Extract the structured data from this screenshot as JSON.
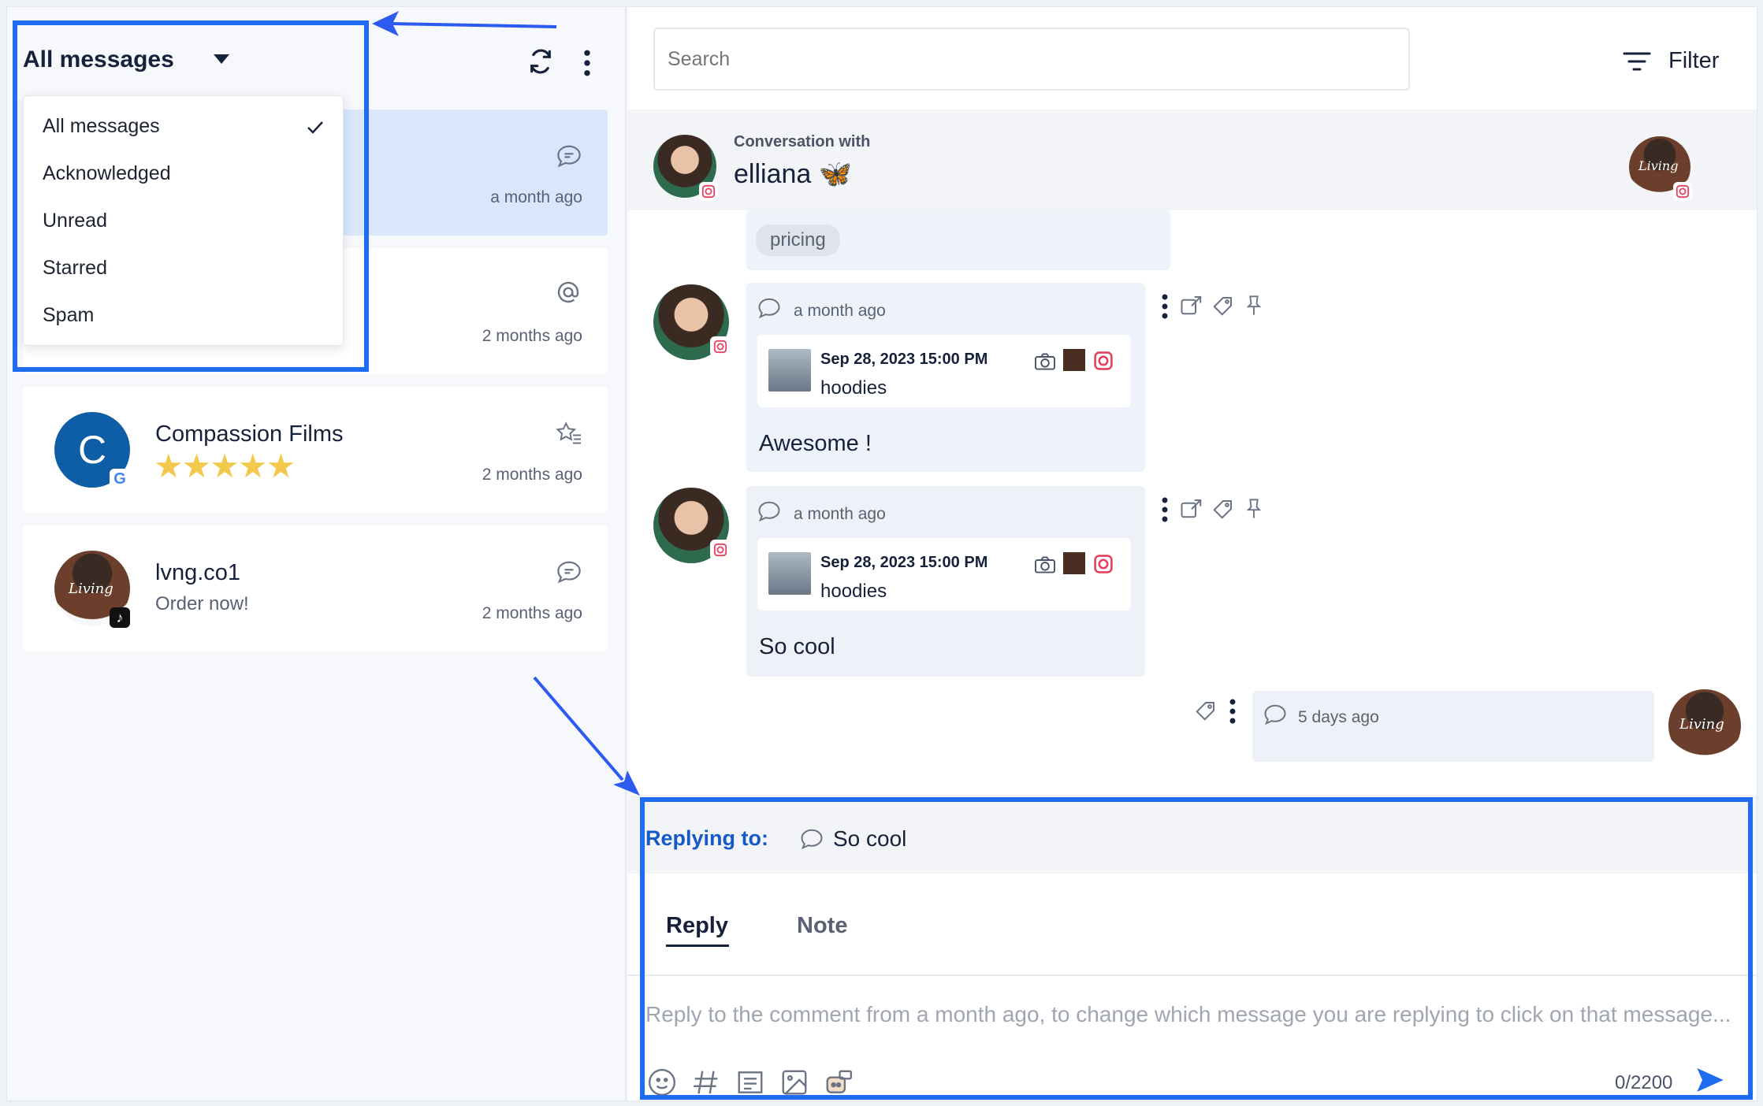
{
  "left_panel": {
    "filter_title": "All messages",
    "dropdown": {
      "items": [
        {
          "label": "All messages",
          "selected": true
        },
        {
          "label": "Acknowledged",
          "selected": false
        },
        {
          "label": "Unread",
          "selected": false
        },
        {
          "label": "Starred",
          "selected": false
        },
        {
          "label": "Spam",
          "selected": false
        }
      ]
    },
    "conversations": [
      {
        "name": "",
        "subtitle": "",
        "time": "a month ago",
        "icon": "chat-bubble-icon",
        "selected": true
      },
      {
        "name": "",
        "subtitle": "",
        "time": "2 months ago",
        "icon": "at-mention-icon",
        "selected": false
      },
      {
        "name": "Compassion Films",
        "rating": "★★★★★",
        "rating_value": 5,
        "time": "2 months ago",
        "icon": "star-list-icon",
        "avatar_letter": "C",
        "source": "google",
        "selected": false
      },
      {
        "name": "lvng.co1",
        "subtitle": "Order now!",
        "time": "2 months ago",
        "icon": "chat-bubble-icon",
        "source": "tiktok",
        "selected": false
      }
    ]
  },
  "right_panel": {
    "search_placeholder": "Search",
    "filter_label": "Filter",
    "conversation_with_label": "Conversation with",
    "contact_name": "elliana",
    "contact_emoji": "🦋",
    "messages": [
      {
        "tag": "pricing"
      },
      {
        "time": "a month ago",
        "post_date": "Sep 28, 2023 15:00 PM",
        "post_caption": "hoodies",
        "text": "Awesome !"
      },
      {
        "time": "a month ago",
        "post_date": "Sep 28, 2023 15:00 PM",
        "post_caption": "hoodies",
        "text": "So cool"
      },
      {
        "time": "5 days ago",
        "outgoing": true
      }
    ],
    "reply": {
      "replying_to_label": "Replying to:",
      "replying_to_text": "So cool",
      "tabs": [
        {
          "label": "Reply",
          "active": true
        },
        {
          "label": "Note",
          "active": false
        }
      ],
      "placeholder": "Reply to the comment from a month ago, to change which message you are replying to click on that message...",
      "counter": "0/2200"
    }
  },
  "colors": {
    "accent": "#1f6cf0",
    "replying_blue": "#1558c8",
    "star": "#f2c94c",
    "instagram": "#e4405f"
  }
}
